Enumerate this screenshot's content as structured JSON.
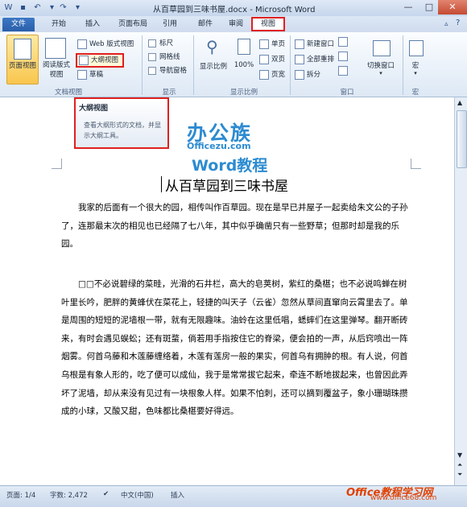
{
  "window": {
    "title": "从百草园到三味书屋.docx - Microsoft Word"
  },
  "tabs": [
    {
      "label": "文件"
    },
    {
      "label": "开始"
    },
    {
      "label": "插入"
    },
    {
      "label": "页面布局"
    },
    {
      "label": "引用"
    },
    {
      "label": "邮件"
    },
    {
      "label": "审阅"
    },
    {
      "label": "视图"
    }
  ],
  "ribbon": {
    "doc_views": {
      "page_view": "页面视图",
      "reading_view_1": "阅读版式",
      "reading_view_2": "视图",
      "web_view": "Web 版式视图",
      "outline_view": "大纲视图",
      "draft_view": "草稿",
      "group_label": "文档视图"
    },
    "show": {
      "ruler": "标尺",
      "gridlines": "网格线",
      "nav_pane": "导航窗格",
      "group_label": "显示"
    },
    "zoom": {
      "zoom": "显示比例",
      "hundred": "100%",
      "one_page": "单页",
      "two_pages": "双页",
      "page_width": "页宽",
      "group_label": "显示比例"
    },
    "window": {
      "new_window": "新建窗口",
      "arrange_all": "全部重排",
      "split": "拆分",
      "switch_windows": "切换窗口",
      "group_label": "窗口"
    },
    "macros": {
      "label": "宏",
      "group_label": "宏"
    }
  },
  "tooltip": {
    "title": "大纲视图",
    "desc": "查看大纲形式的文档，并显示大纲工具。"
  },
  "logo": {
    "line1": "办公族",
    "line2": "Officezu.com",
    "line3": "Word教程"
  },
  "document": {
    "title": "从百草园到三味书屋",
    "paragraphs": [
      "我家的后面有一个很大的园，相传叫作百草园。现在是早已并屋子一起卖给朱文公的子孙了，连那最末次的相见也已经隔了七八年，其中似乎确凿只有一些野草；但那时却是我的乐园。",
      "□□不必说碧绿的菜畦，光滑的石井栏，高大的皂荚树，紫红的桑椹；也不必说鸣蝉在树叶里长吟，肥胖的黄蜂伏在菜花上，轻捷的叫天子（云雀）忽然从草间直窜向云霄里去了。单是周围的短短的泥墙根一带，就有无限趣味。油蛉在这里低唱，蟋蟀们在这里弹琴。翻开断砖来，有时会遇见蜈蚣；还有斑蝥，倘若用手指按住它的脊梁，便会拍的一声，从后窍喷出一阵烟雾。何首乌藤和木莲藤缠络着，木莲有莲房一般的果实，何首乌有拥肿的根。有人说，何首乌根是有象人形的，吃了便可以成仙，我于是常常拔它起来，牵连不断地拔起来，也曾因此弄坏了泥墙，却从来没有见过有一块根象人样。如果不怕刺，还可以摘到覆盆子，象小珊瑚珠攒成的小球，又酸又甜，色味都比桑椹要好得远。"
    ]
  },
  "status": {
    "page": "页面: 1/4",
    "words": "字数: 2,472",
    "language": "中文(中国)",
    "insert": "插入"
  },
  "watermark": {
    "line1": "Office教程学习网",
    "line2": "www.office68.com"
  }
}
